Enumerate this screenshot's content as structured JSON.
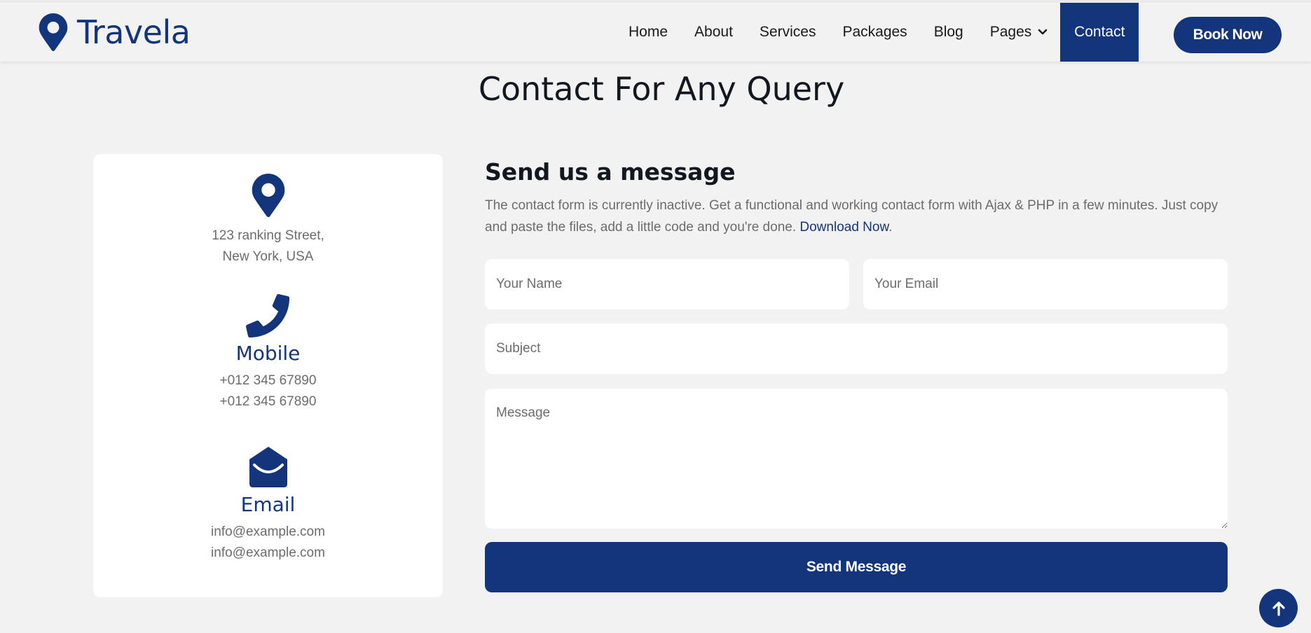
{
  "navbar": {
    "brand": "Travela",
    "brand_icon": "map-marker-icon",
    "items": [
      {
        "label": "Home"
      },
      {
        "label": "About"
      },
      {
        "label": "Services"
      },
      {
        "label": "Packages"
      },
      {
        "label": "Blog"
      },
      {
        "label": "Pages",
        "has_dropdown": true
      }
    ],
    "active_item": "Contact",
    "cta": "Book Now"
  },
  "page": {
    "title": "Contact For Any Query"
  },
  "info_card": {
    "address": {
      "icon": "map-marker-icon",
      "lines": [
        "123 ranking Street,",
        "New York, USA"
      ]
    },
    "mobile": {
      "icon": "phone-icon",
      "heading": "Mobile",
      "lines": [
        "+012 345 67890",
        "+012 345 67890"
      ]
    },
    "email": {
      "icon": "envelope-open-icon",
      "heading": "Email",
      "lines": [
        "info@example.com",
        "info@example.com"
      ]
    }
  },
  "form": {
    "title": "Send us a message",
    "description": "The contact form is currently inactive. Get a functional and working contact form with Ajax & PHP in a few minutes. Just copy and paste the files, add a little code and you're done.",
    "link_text": "Download Now",
    "link_suffix": ".",
    "name_placeholder": "Your Name",
    "email_placeholder": "Your Email",
    "subject_placeholder": "Subject",
    "message_placeholder": "Message",
    "submit": "Send Message"
  },
  "back_to_top_icon": "arrow-up-icon",
  "colors": {
    "primary": "#13357b",
    "background": "#f2f2f2",
    "card": "#ffffff",
    "text_muted": "#6c6c6c",
    "text_dark": "#13171f"
  }
}
